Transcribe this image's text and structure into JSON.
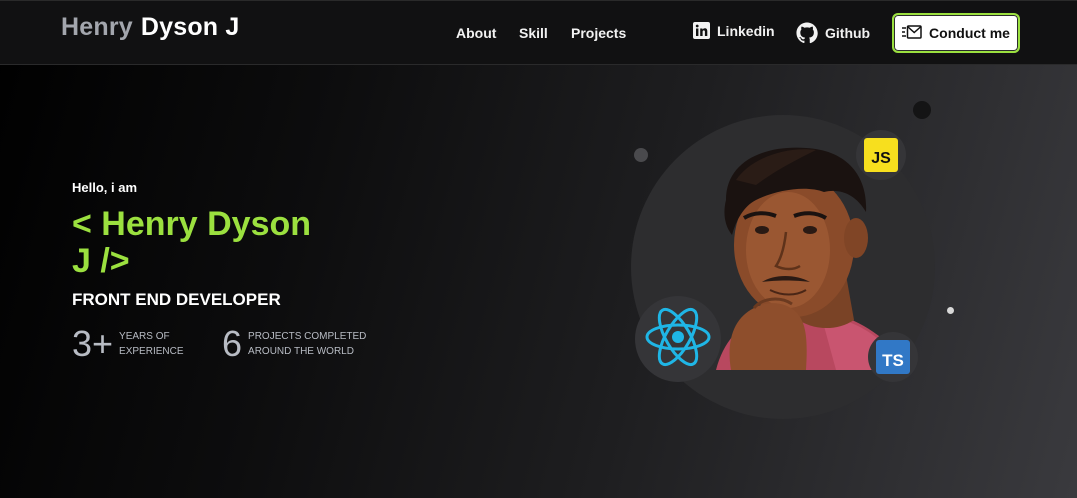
{
  "header": {
    "brand_first": "Henry",
    "brand_last": "Dyson J",
    "nav": [
      "About",
      "Skill",
      "Projects"
    ],
    "linkedin_label": "Linkedin",
    "github_label": "Github",
    "contact_label": "Conduct me"
  },
  "hero": {
    "greeting": "Hello, i am",
    "name": "< Henry Dyson J />",
    "role": "FRONT END DEVELOPER",
    "stats": [
      {
        "value": "3+",
        "line1": "YEARS OF",
        "line2": "EXPERIENCE"
      },
      {
        "value": "6",
        "line1": "PROJECTS COMPLETED",
        "line2": "AROUND THE WORLD"
      }
    ]
  },
  "badges": {
    "js": "JS",
    "ts": "TS"
  },
  "colors": {
    "accent": "#9be03f",
    "react": "#1fb6e6",
    "js_bg": "#f7df1e",
    "ts_bg": "#3178c6"
  },
  "icons": [
    "linkedin-icon",
    "github-icon",
    "mail-icon",
    "react-icon",
    "javascript-icon",
    "typescript-icon"
  ]
}
